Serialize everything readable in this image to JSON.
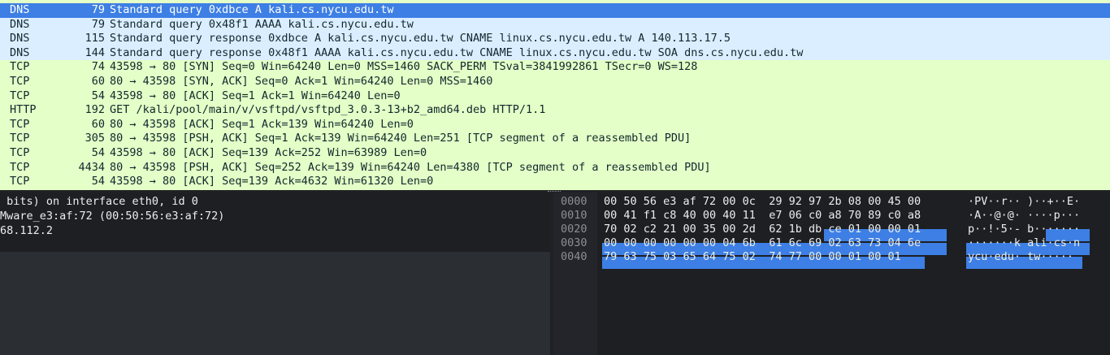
{
  "packet_list": {
    "rows": [
      {
        "proto": "DNS",
        "len": "79",
        "info": "Standard query 0xdbce A kali.cs.nycu.edu.tw",
        "kind": "dns",
        "selected": true
      },
      {
        "proto": "DNS",
        "len": "79",
        "info": "Standard query 0x48f1 AAAA kali.cs.nycu.edu.tw",
        "kind": "dns"
      },
      {
        "proto": "DNS",
        "len": "115",
        "info": "Standard query response 0xdbce A kali.cs.nycu.edu.tw CNAME linux.cs.nycu.edu.tw A 140.113.17.5",
        "kind": "dns"
      },
      {
        "proto": "DNS",
        "len": "144",
        "info": "Standard query response 0x48f1 AAAA kali.cs.nycu.edu.tw CNAME linux.cs.nycu.edu.tw SOA dns.cs.nycu.edu.tw",
        "kind": "dns"
      },
      {
        "proto": "TCP",
        "len": "74",
        "info": "43598 → 80 [SYN] Seq=0 Win=64240 Len=0 MSS=1460 SACK_PERM TSval=3841992861 TSecr=0 WS=128",
        "kind": "tcp"
      },
      {
        "proto": "TCP",
        "len": "60",
        "info": "80 → 43598 [SYN, ACK] Seq=0 Ack=1 Win=64240 Len=0 MSS=1460",
        "kind": "tcp"
      },
      {
        "proto": "TCP",
        "len": "54",
        "info": "43598 → 80 [ACK] Seq=1 Ack=1 Win=64240 Len=0",
        "kind": "tcp"
      },
      {
        "proto": "HTTP",
        "len": "192",
        "info": "GET /kali/pool/main/v/vsftpd/vsftpd_3.0.3-13+b2_amd64.deb HTTP/1.1",
        "kind": "http"
      },
      {
        "proto": "TCP",
        "len": "60",
        "info": "80 → 43598 [ACK] Seq=1 Ack=139 Win=64240 Len=0",
        "kind": "tcp"
      },
      {
        "proto": "TCP",
        "len": "305",
        "info": "80 → 43598 [PSH, ACK] Seq=1 Ack=139 Win=64240 Len=251 [TCP segment of a reassembled PDU]",
        "kind": "tcp"
      },
      {
        "proto": "TCP",
        "len": "54",
        "info": "43598 → 80 [ACK] Seq=139 Ack=252 Win=63989 Len=0",
        "kind": "tcp"
      },
      {
        "proto": "TCP",
        "len": "4434",
        "info": "80 → 43598 [PSH, ACK] Seq=252 Ack=139 Win=64240 Len=4380 [TCP segment of a reassembled PDU]",
        "kind": "tcp"
      },
      {
        "proto": "TCP",
        "len": "54",
        "info": "43598 → 80 [ACK] Seq=139 Ack=4632 Win=61320 Len=0",
        "kind": "tcp"
      }
    ]
  },
  "details": {
    "lines": [
      " bits) on interface eth0, id 0",
      "Mware_e3:af:72 (00:50:56:e3:af:72)",
      "68.112.2"
    ]
  },
  "bytes_pane": {
    "rows": [
      {
        "offset": "0000",
        "hex": "00 50 56 e3 af 72 00 0c  29 92 97 2b 08 00 45 00",
        "ascii": "·PV··r·· )··+··E·"
      },
      {
        "offset": "0010",
        "hex": "00 41 f1 c8 40 00 40 11  e7 06 c0 a8 70 89 c0 a8",
        "ascii": "·A··@·@· ····p···"
      },
      {
        "offset": "0020",
        "hex": "70 02 c2 21 00 35 00 2d  62 1b db ce 01 00 00 01",
        "ascii": "p··!·5·- b·······"
      },
      {
        "offset": "0030",
        "hex": "00 00 00 00 00 00 04 6b  61 6c 69 02 63 73 04 6e",
        "ascii": "·······k ali·cs·n"
      },
      {
        "offset": "0040",
        "hex": "79 63 75 03 65 64 75 02  74 77 00 00 01 00 01",
        "ascii": "ycu·edu· tw·····"
      }
    ]
  },
  "colors": {
    "selected_row": "#3d7fe4",
    "dns_row": "#daeeff",
    "tcp_row": "#e4ffc7",
    "byte_highlight": "#3d7fe4"
  }
}
